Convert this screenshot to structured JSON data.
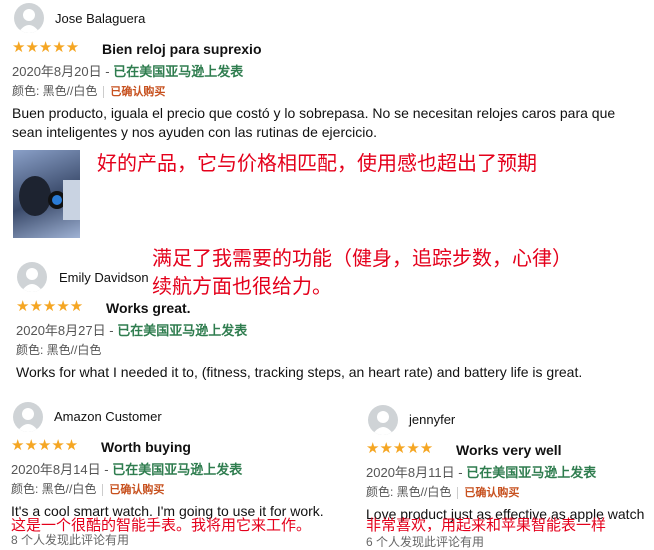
{
  "reviews": [
    {
      "name": "Jose Balaguera",
      "stars": "★★★★★",
      "title": "Bien reloj para suprexio",
      "date": "2020年8月20日",
      "verified": "已在美国亚马逊上发表",
      "variant": "颜色: 黑色//白色",
      "badge": "已确认购买",
      "body1": "Buen producto, iguala el precio que costó y lo sobrepasa. No se necesitan relojes caros para que",
      "body2": "sean inteligentes y nos ayuden con las rutinas de ejercicio."
    },
    {
      "name": "Emily Davidson",
      "stars": "★★★★★",
      "title": "Works great.",
      "date": "2020年8月27日",
      "verified": "已在美国亚马逊上发表",
      "variant": "颜色: 黑色//白色",
      "body": "Works for what I needed it to, (fitness, tracking steps, an heart rate) and battery life is great."
    },
    {
      "name": "Amazon Customer",
      "stars": "★★★★★",
      "title": "Worth buying",
      "date": "2020年8月14日",
      "verified": "已在美国亚马逊上发表",
      "variant": "颜色: 黑色//白色",
      "badge": "已确认购买",
      "body": "It's a cool smart watch. I'm going to use it for work.",
      "helpful": "8 个人发现此评论有用"
    },
    {
      "name": "jennyfer",
      "stars": "★★★★★",
      "title": "Works very well",
      "date": "2020年8月11日",
      "verified": "已在美国亚马逊上发表",
      "variant": "颜色: 黑色//白色",
      "badge": "已确认购买",
      "body": "Love product just as effective as apple watch",
      "helpful": "6 个人发现此评论有用"
    }
  ],
  "annotations": {
    "a1": "好的产品，它与价格相匹配，使用感也超出了预期",
    "a2_line1": "满足了我需要的功能（健身，追踪步数，心律）",
    "a2_line2": "续航方面也很给力。",
    "a3": "这是一个很酷的智能手表。我将用它来工作。",
    "a4": "非常喜欢，用起来和苹果智能表一样"
  },
  "separator": "-",
  "colors": {
    "star": "#f5a623",
    "verified": "#2f7d4f",
    "badge": "#c7511f",
    "annotation": "#e4001b"
  }
}
